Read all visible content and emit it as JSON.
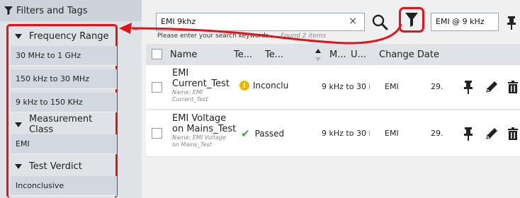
{
  "sidebar": {
    "title": "Filters and Tags",
    "categories": [
      {
        "label": "Frequency Range",
        "items": [
          "30 MHz to 1 GHz",
          "150 kHz to 30 MHz",
          "9 kHz to 150 KHz"
        ]
      },
      {
        "label": "Measurement Class",
        "items": [
          "EMI"
        ]
      },
      {
        "label": "Test Verdict",
        "items": [
          "Inconclusive"
        ]
      }
    ]
  },
  "search": {
    "value": "EMI 9khz",
    "clear": "×",
    "hint": "Please enter your search keywords",
    "found": "Found 2 items"
  },
  "preset": {
    "value": "EMI @ 9 kHz"
  },
  "table": {
    "columns": [
      "Name",
      "Te...",
      "Te...",
      "M...",
      "U...",
      "Change Date"
    ],
    "rows": [
      {
        "name": "EMI Current_Test",
        "name_line1": "EMI",
        "name_line2": "Current_Test",
        "sub_line1": "Name: EMI",
        "sub_line2": "Current_Test",
        "status": "Inconclu",
        "unit": "9 kHz to 30 M",
        "class": "EMI",
        "date": "29.0"
      },
      {
        "name": "EMI Voltage on Mains_Test",
        "name_line1": "EMI Voltage",
        "name_line2": "on Mains_Test",
        "sub_line1": "Name: EMI Voltage",
        "sub_line2": "on Mains_Test",
        "status": "Passed",
        "unit": "9 kHz to 30 M",
        "class": "EMI",
        "date": "29.0"
      }
    ]
  },
  "colors": {
    "highlight": "#e1141a",
    "sidebar_bg": "#dfe3e8",
    "item_bg": "#d2d8df",
    "warn": "#f2b600",
    "ok": "#2faa3a"
  }
}
